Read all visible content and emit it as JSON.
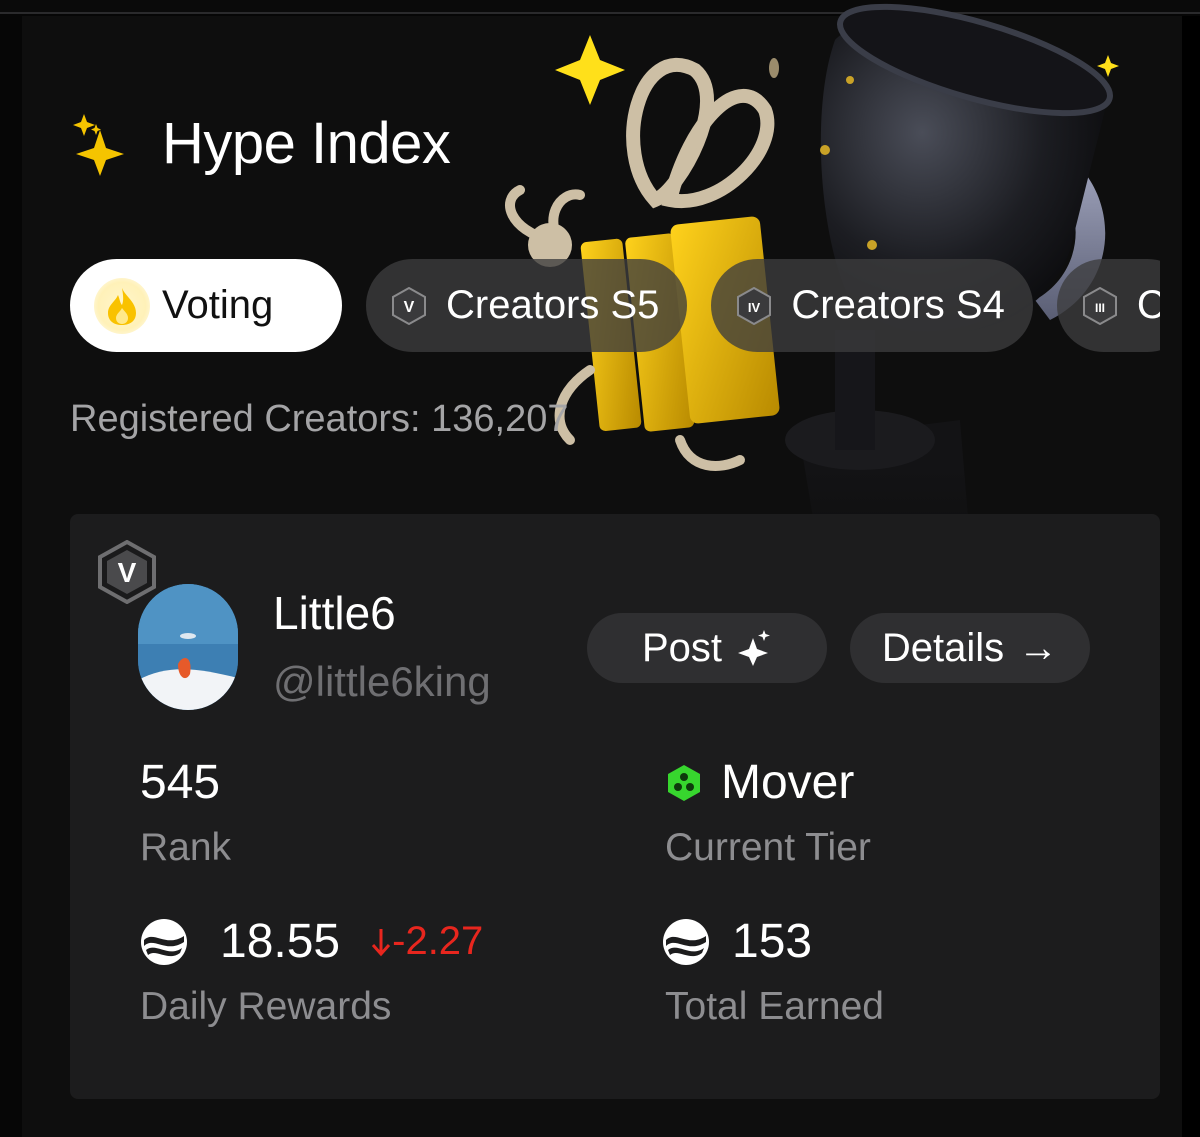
{
  "header": {
    "title": "Hype Index",
    "title_icon": "sparkles-icon"
  },
  "tabs": [
    {
      "label": "Voting",
      "icon": "flame-icon",
      "active": true
    },
    {
      "label": "Creators S5",
      "icon": "tier-v-icon",
      "badge": "V",
      "active": false
    },
    {
      "label": "Creators S4",
      "icon": "tier-iv-icon",
      "badge": "IV",
      "active": false
    },
    {
      "label": "C",
      "icon": "tier-iii-icon",
      "badge": "III",
      "active": false
    }
  ],
  "registered": {
    "text": "Registered Creators: 136,207"
  },
  "profile": {
    "tier_badge": "V",
    "display_name": "Little6",
    "handle": "@little6king",
    "post_label": "Post",
    "details_label": "Details",
    "details_arrow": "→"
  },
  "stats": {
    "rank_value": "545",
    "rank_label": "Rank",
    "tier_value": "Mover",
    "tier_label": "Current Tier",
    "daily_value": "18.55",
    "daily_change": "-2.27",
    "daily_label": "Daily Rewards",
    "total_value": "153",
    "total_label": "Total Earned"
  },
  "colors": {
    "accent_yellow": "#f5c400",
    "negative_red": "#e8261e",
    "mover_green": "#37d62e"
  }
}
